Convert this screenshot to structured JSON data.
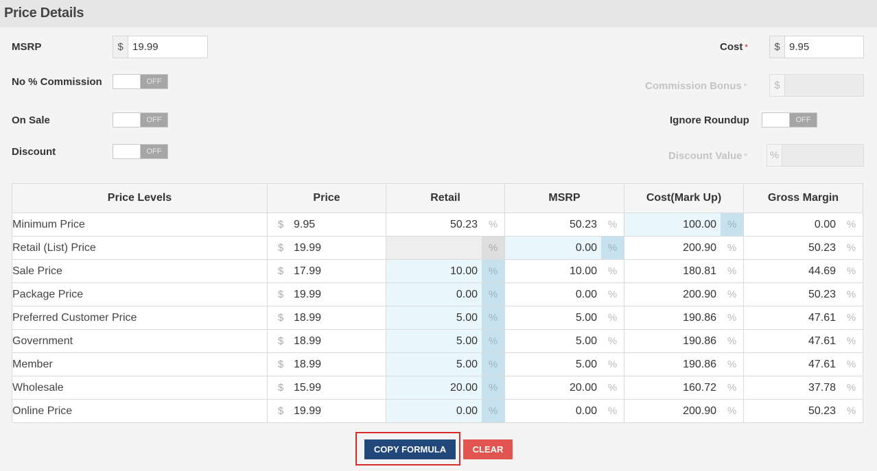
{
  "header": {
    "title": "Price Details"
  },
  "form": {
    "msrp": {
      "label": "MSRP",
      "currency": "$",
      "value": "19.99"
    },
    "cost": {
      "label": "Cost",
      "required_mark": "*",
      "currency": "$",
      "value": "9.95"
    },
    "no_commission": {
      "label": "No % Commission",
      "state": "OFF"
    },
    "commission_bonus": {
      "label": "Commission Bonus",
      "required_mark": "*",
      "currency": "$",
      "value": ""
    },
    "on_sale": {
      "label": "On Sale",
      "state": "OFF"
    },
    "ignore_roundup": {
      "label": "Ignore Roundup",
      "state": "OFF"
    },
    "discount": {
      "label": "Discount",
      "state": "OFF"
    },
    "discount_value": {
      "label": "Discount Value",
      "required_mark": "*",
      "unit": "%",
      "value": ""
    }
  },
  "table": {
    "headers": [
      "Price Levels",
      "Price",
      "Retail",
      "MSRP",
      "Cost(Mark Up)",
      "Gross Margin"
    ],
    "currency": "$",
    "pct": "%",
    "rows": [
      {
        "name": "Minimum Price",
        "price": "9.95",
        "retail": "50.23",
        "msrp": "50.23",
        "cost": "100.00",
        "margin": "0.00"
      },
      {
        "name": "Retail (List) Price",
        "price": "19.99",
        "retail": "",
        "msrp": "0.00",
        "cost": "200.90",
        "margin": "50.23"
      },
      {
        "name": "Sale Price",
        "price": "17.99",
        "retail": "10.00",
        "msrp": "10.00",
        "cost": "180.81",
        "margin": "44.69"
      },
      {
        "name": "Package Price",
        "price": "19.99",
        "retail": "0.00",
        "msrp": "0.00",
        "cost": "200.90",
        "margin": "50.23"
      },
      {
        "name": "Preferred Customer Price",
        "price": "18.99",
        "retail": "5.00",
        "msrp": "5.00",
        "cost": "190.86",
        "margin": "47.61"
      },
      {
        "name": "Government",
        "price": "18.99",
        "retail": "5.00",
        "msrp": "5.00",
        "cost": "190.86",
        "margin": "47.61"
      },
      {
        "name": "Member",
        "price": "18.99",
        "retail": "5.00",
        "msrp": "5.00",
        "cost": "190.86",
        "margin": "47.61"
      },
      {
        "name": "Wholesale",
        "price": "15.99",
        "retail": "20.00",
        "msrp": "20.00",
        "cost": "160.72",
        "margin": "37.78"
      },
      {
        "name": "Online Price",
        "price": "19.99",
        "retail": "0.00",
        "msrp": "0.00",
        "cost": "200.90",
        "margin": "50.23"
      }
    ]
  },
  "actions": {
    "copy_formula": "COPY FORMULA",
    "clear": "CLEAR"
  },
  "colors": {
    "primary": "#22477a",
    "danger": "#e25450",
    "highlight": "#e9f6fc",
    "highlight_addon": "#c7e2ee",
    "focus_outline": "#d62b2b"
  }
}
